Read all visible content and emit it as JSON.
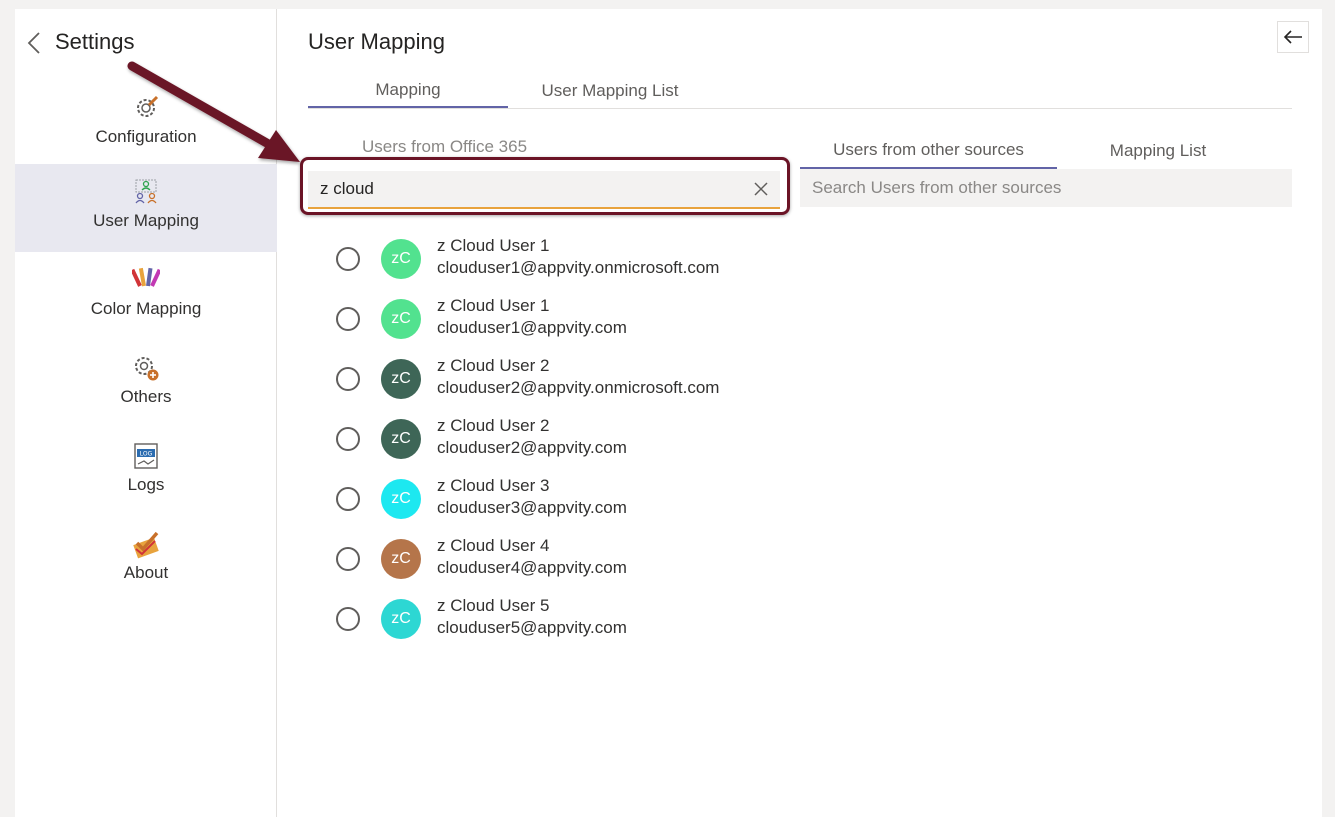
{
  "sidebar": {
    "title": "Settings",
    "items": [
      {
        "label": "Configuration",
        "icon": "gear-wrench-icon"
      },
      {
        "label": "User Mapping",
        "icon": "user-mapping-icon"
      },
      {
        "label": "Color Mapping",
        "icon": "color-palette-icon"
      },
      {
        "label": "Others",
        "icon": "gear-plus-icon"
      },
      {
        "label": "Logs",
        "icon": "log-icon"
      },
      {
        "label": "About",
        "icon": "about-checkmark-icon"
      }
    ]
  },
  "main": {
    "title": "User Mapping",
    "tabs": [
      {
        "label": "Mapping"
      },
      {
        "label": "User Mapping List"
      }
    ],
    "left_pane": {
      "label": "Users from Office 365",
      "search_value": "z cloud"
    },
    "right_pane": {
      "tabs": [
        {
          "label": "Users from other sources"
        },
        {
          "label": "Mapping List"
        }
      ],
      "search_placeholder": "Search Users from other sources"
    },
    "users": [
      {
        "initials": "zC",
        "name": "z Cloud User 1",
        "email": "clouduser1@appvity.onmicrosoft.com",
        "color": "#52e28f"
      },
      {
        "initials": "zC",
        "name": "z Cloud User 1",
        "email": "clouduser1@appvity.com",
        "color": "#52e28f"
      },
      {
        "initials": "zC",
        "name": "z Cloud User 2",
        "email": "clouduser2@appvity.onmicrosoft.com",
        "color": "#3e6657"
      },
      {
        "initials": "zC",
        "name": "z Cloud User 2",
        "email": "clouduser2@appvity.com",
        "color": "#3e6657"
      },
      {
        "initials": "zC",
        "name": "z Cloud User 3",
        "email": "clouduser3@appvity.com",
        "color": "#1de8f0"
      },
      {
        "initials": "zC",
        "name": "z Cloud User 4",
        "email": "clouduser4@appvity.com",
        "color": "#b5754a"
      },
      {
        "initials": "zC",
        "name": "z Cloud User 5",
        "email": "clouduser5@appvity.com",
        "color": "#2dd7d3"
      }
    ]
  },
  "colors": {
    "accent": "#6264a7",
    "search_underline": "#e8a33d",
    "annotation": "#6b1426",
    "active_nav_bg": "#e8e8f0"
  }
}
